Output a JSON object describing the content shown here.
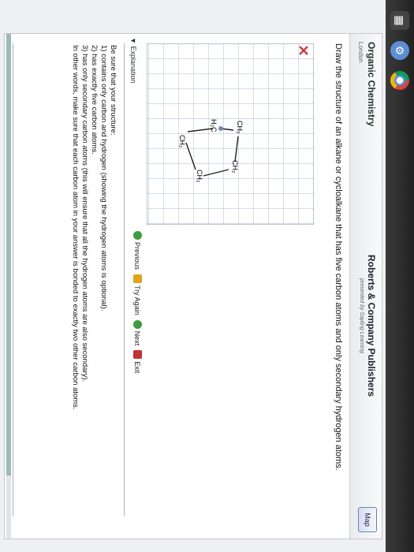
{
  "header": {
    "course_title": "Organic Chemistry",
    "course_sub": "London",
    "publisher": "Roberts & Company Publishers",
    "publisher_sub": "presented by Sapling Learning",
    "map_label": "Map"
  },
  "question": "Draw the structure of an alkane or cycloalkane that has five carbon atoms and only secondary hydrogen atoms.",
  "structure_labels": {
    "ch2_top": "CH₂",
    "ch2_top_right": "CH₂",
    "ch2_right": "CH₂",
    "h2c_left": "H₂C",
    "ch2_bottom": "CH₂"
  },
  "explanation_label": "Explanation",
  "nav": {
    "previous": "Previous",
    "try_again": "Try Again",
    "next": "Next",
    "exit": "Exit"
  },
  "explanation_lines": [
    "Be sure that your structure:",
    "1) contains only carbon and hydrogen (showing the hydrogen atoms is optional).",
    "2) has exactly five carbon atoms.",
    "3) has only secondary carbon atoms (this will ensure that all the hydrogen atoms are also secondary).",
    "    In other words, make sure that each carbon atom in your answer is bonded to exactly two other carbon atoms."
  ],
  "colors": {
    "incorrect_mark": "#d23b3b",
    "accent_green": "#3d9c3d"
  }
}
